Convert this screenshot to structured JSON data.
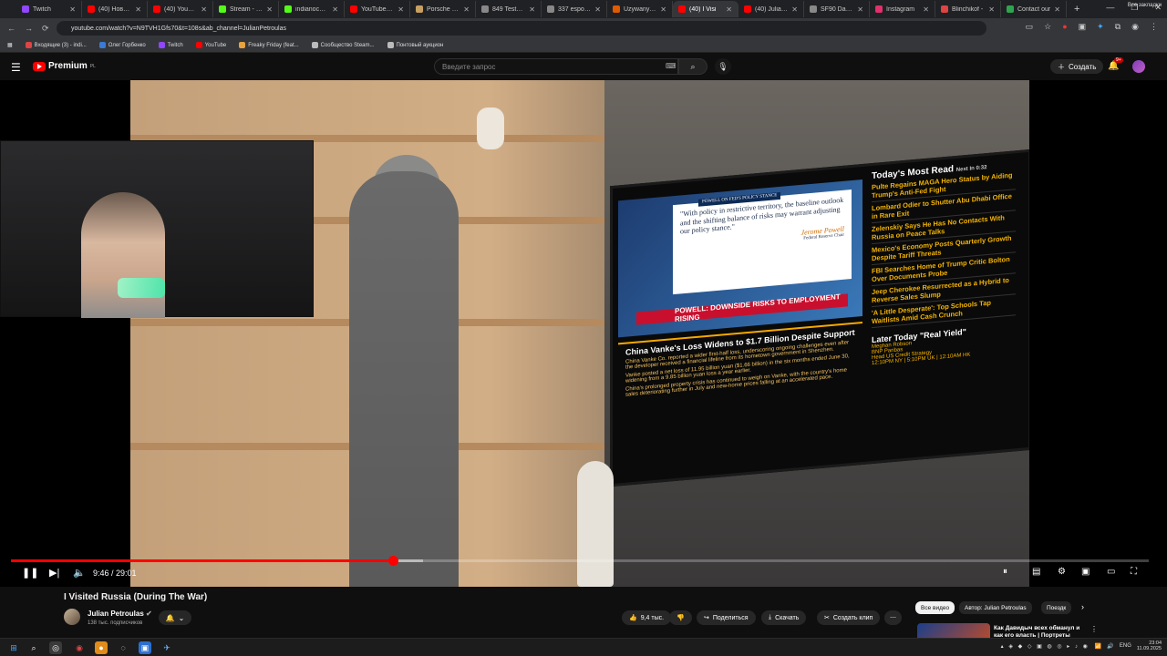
{
  "browser": {
    "tabs": [
      {
        "label": "Twitch",
        "color": "#9146ff",
        "active": false
      },
      {
        "label": "(40) Новый Р",
        "color": "#ff0000",
        "active": false
      },
      {
        "label": "(40) YouTube",
        "color": "#ff0000",
        "active": false
      },
      {
        "label": "Stream - Kick",
        "color": "#53fc18",
        "active": false
      },
      {
        "label": "indianoch St",
        "color": "#53fc18",
        "active": false
      },
      {
        "label": "YouTube Mu",
        "color": "#ff0000",
        "active": false
      },
      {
        "label": "Porsche Car C",
        "color": "#c8a060",
        "active": false
      },
      {
        "label": "849 Testaros",
        "color": "#888888",
        "active": false
      },
      {
        "label": "337 espo в д",
        "color": "#888888",
        "active": false
      },
      {
        "label": "Uzywany Fer",
        "color": "#e05a00",
        "active": false
      },
      {
        "label": "(40) I Visi",
        "color": "#ff0000",
        "active": true
      },
      {
        "label": "(40) Julian P",
        "color": "#ff0000",
        "active": false
      },
      {
        "label": "SF90 Darth V",
        "color": "#888888",
        "active": false
      },
      {
        "label": "Instagram",
        "color": "#e1306c",
        "active": false
      },
      {
        "label": "Blinchikof - ",
        "color": "#d44",
        "active": false
      },
      {
        "label": "Contact our",
        "color": "#2ea44f",
        "active": false
      }
    ],
    "url": "youtube.com/watch?v=N9TVH1Gfs70&t=108s&ab_channel=JulianPetroulas",
    "bookmarks": [
      "Входящие (3) - indi...",
      "Олег Горбенко",
      "Twitch",
      "YouTube",
      "Freaky Friday (feat...",
      "Сообщество Steam...",
      "Понтовый аукцион"
    ],
    "all_bookmarks": "Все закладки"
  },
  "youtube": {
    "logo_text": "Premium",
    "logo_sup": "PL",
    "search_placeholder": "Введите запрос",
    "create_label": "Создать",
    "notif_count": "9+"
  },
  "tv": {
    "tag": "POWELL ON FED'S POLICY STANCE",
    "quote": "\"With policy in restrictive territory, the baseline outlook and the shifting balance of risks may warrant adjusting our policy stance.\"",
    "quote_author": "Jerome Powell",
    "quote_role": "Federal Reserve Chair",
    "breaking": "POWELL: DOWNSIDE RISKS TO EMPLOYMENT RISING",
    "china_headline": "China Vanke's Loss Widens to $1.7 Billion Despite Support",
    "china_points": [
      "China Vanke Co. reported a wider first-half loss, underscoring ongoing challenges even after the developer received a financial lifeline from its hometown government in Shenzhen.",
      "Vanke posted a net loss of 11.95 billion yuan ($1.66 billion) in the six months ended June 30, widening from a 9.85 billion yuan loss a year earlier.",
      "China's prolonged property crisis has continued to weigh on Vanke, with the country's home sales deteriorating further in July and new-home prices falling at an accelerated pace."
    ],
    "most_read_title": "Today's Most Read",
    "next_label": "Next In 0:32",
    "most_read": [
      "Pulte Regains MAGA Hero Status by Aiding Trump's Anti-Fed Fight",
      "Lombard Odier to Shutter Abu Dhabi Office in Rare Exit",
      "Zelenskiy Says He Has No Contacts With Russia on Peace Talks",
      "Mexico's Economy Posts Quarterly Growth Despite Tariff Threats",
      "FBI Searches Home of Trump Critic Bolton Over Documents Probe",
      "Jeep Cherokee Resurrected as a Hybrid to Reverse Sales Slump",
      "'A Little Desperate': Top Schools Tap Waitlists Amid Cash Crunch"
    ],
    "later_title": "Later Today \"Real Yield\"",
    "later_host": "Meghan Robson",
    "later_org": "BNP Paribas",
    "later_role": "Head US Credit Strategy",
    "later_times": "12:10PM NY | 5:10PM UK | 12:10AM HK"
  },
  "player": {
    "progress_fraction": 0.336,
    "buffer_fraction": 0.362,
    "time": "9:46 / 29:01"
  },
  "video_info": {
    "title": "I Visited Russia (During The War)",
    "channel": "Julian Petroulas",
    "subscribers": "138 тыс. подписчиков",
    "likes": "9,4 тыс.",
    "share": "Поделиться",
    "download": "Скачать",
    "clip": "Создать клип"
  },
  "sidebar": {
    "chips": [
      "Все видео",
      "Автор: Julian Petroulas",
      "Поездк"
    ],
    "rec_title": "Как Давидыч всех обманул и как его власть | Портреты"
  },
  "taskbar": {
    "lang": "ENG",
    "time": "23:04",
    "date": "11.09.2025"
  }
}
